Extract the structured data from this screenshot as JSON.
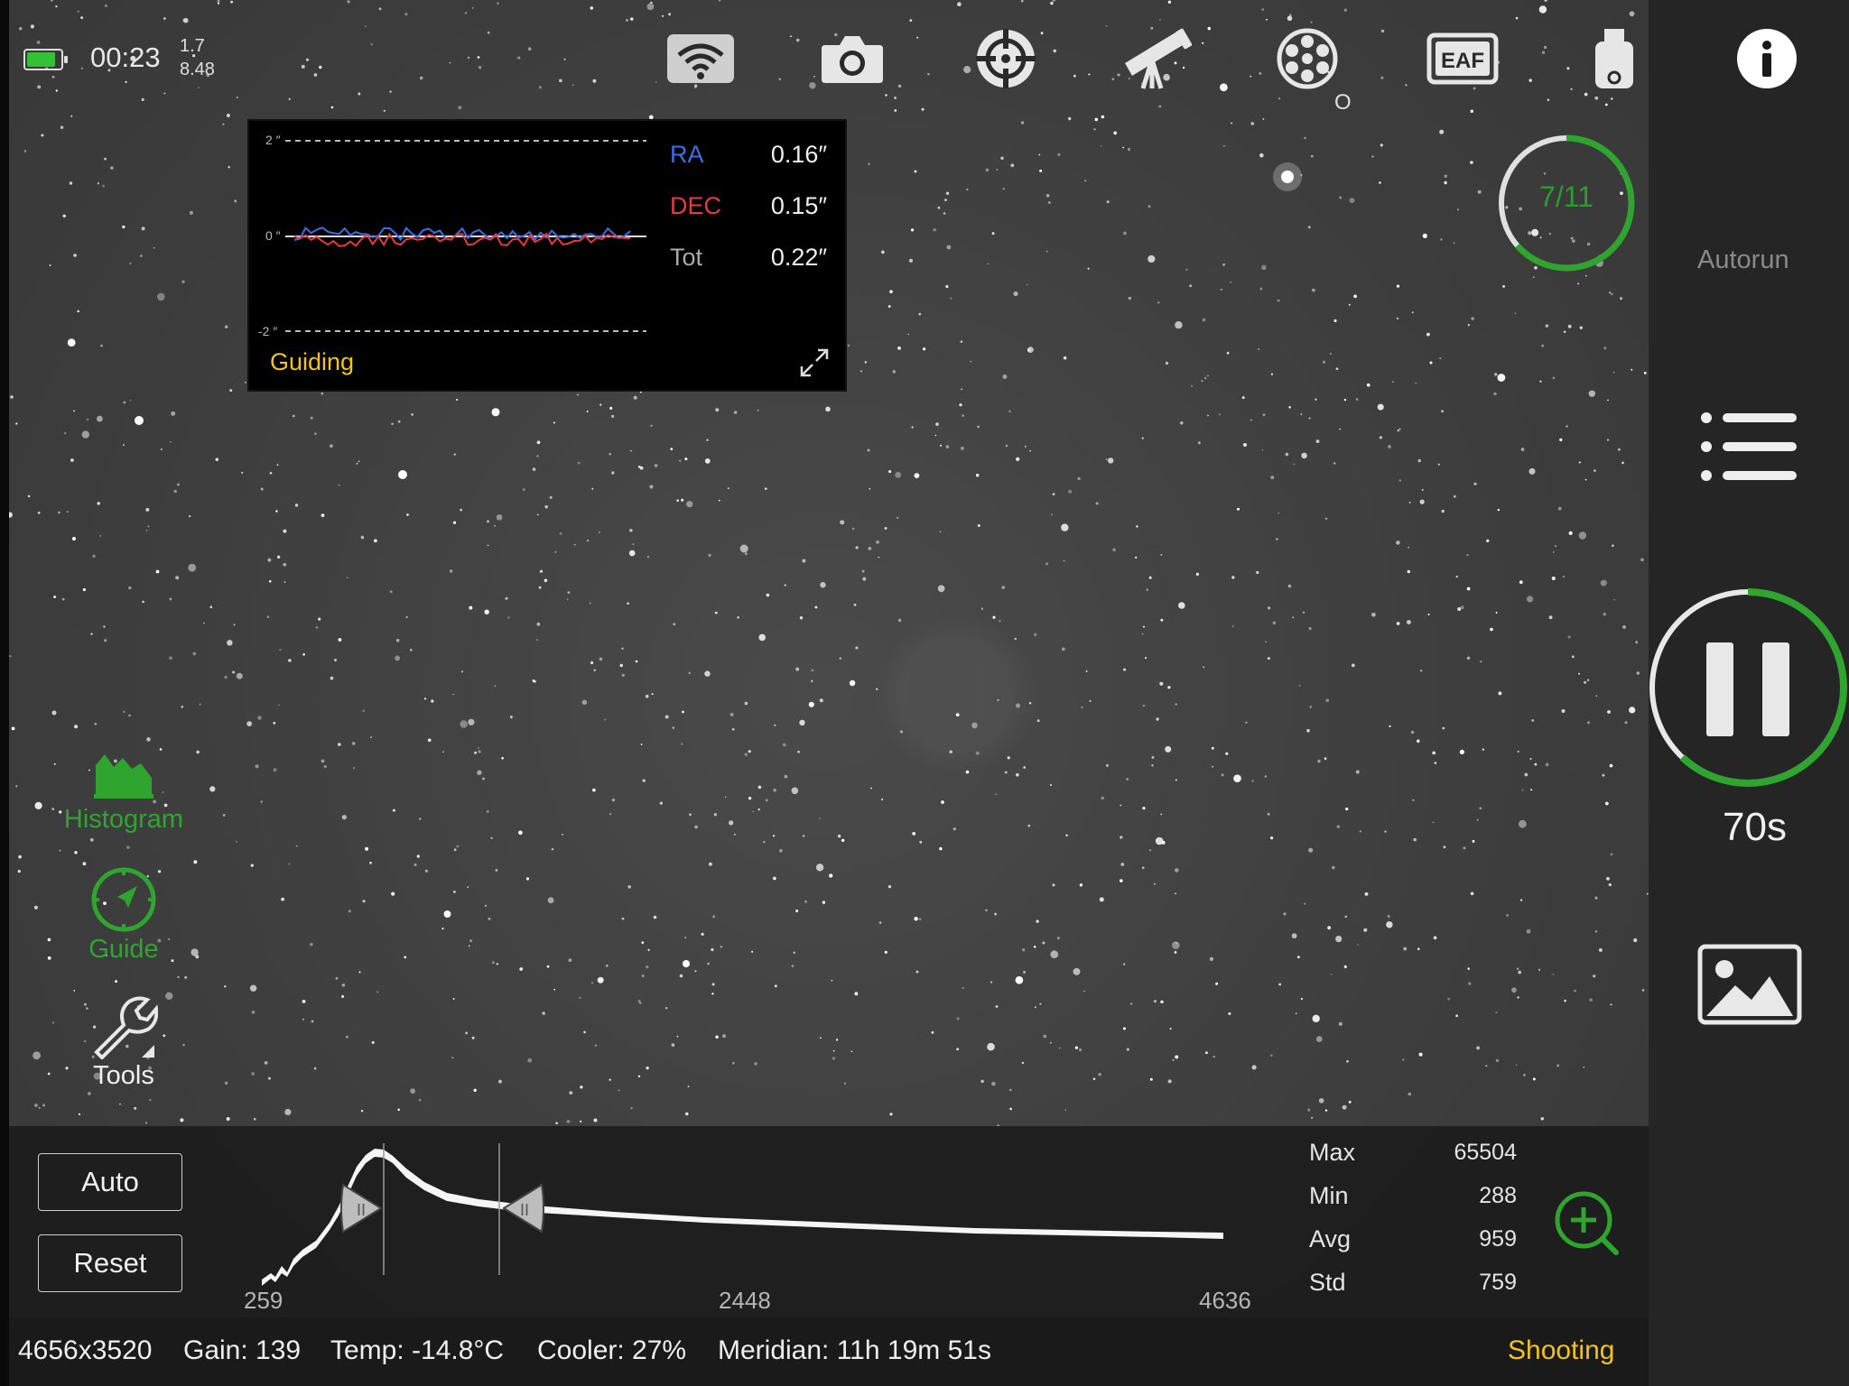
{
  "topbar": {
    "battery_icon": "battery-icon",
    "battery_level": 0.85,
    "time": "00:23",
    "version_line1": "1.7",
    "version_line2": "8.48",
    "icons": [
      "wifi-icon",
      "camera-icon",
      "guide-scope-icon",
      "telescope-icon",
      "filter-wheel-icon",
      "eaf-icon",
      "usb-drive-icon",
      "info-icon"
    ],
    "eaf_label": "EAF",
    "filter_position": "O"
  },
  "guiding": {
    "title": "Guiding",
    "y_top": "2 ″",
    "y_mid": "0 ″",
    "y_bottom": "-2 ″",
    "ra_label": "RA",
    "ra_value": "0.16″",
    "dec_label": "DEC",
    "dec_value": "0.15″",
    "tot_label": "Tot",
    "tot_value": "0.22″",
    "colors": {
      "ra": "#3a6fe8",
      "dec": "#e83a3a",
      "title": "#f3c21b"
    }
  },
  "autorun": {
    "count": "7/11",
    "progress": 0.636,
    "label": "Autorun"
  },
  "capture": {
    "exposure": "70s",
    "progress": 0.62,
    "accent": "#2fa52f"
  },
  "left_tools": {
    "histogram_label": "Histogram",
    "guide_label": "Guide",
    "tools_label": "Tools"
  },
  "histogram": {
    "auto_label": "Auto",
    "reset_label": "Reset",
    "tick_min": "259",
    "tick_mid": "2448",
    "tick_max": "4636",
    "stats": {
      "max_label": "Max",
      "max_value": "65504",
      "min_label": "Min",
      "min_value": "288",
      "avg_label": "Avg",
      "avg_value": "959",
      "std_label": "Std",
      "std_value": "759"
    }
  },
  "status": {
    "resolution": "4656x3520",
    "gain": "Gain: 139",
    "temp": "Temp: -14.8°C",
    "cooler": "Cooler: 27%",
    "meridian": "Meridian: 11h 19m 51s",
    "state": "Shooting"
  }
}
